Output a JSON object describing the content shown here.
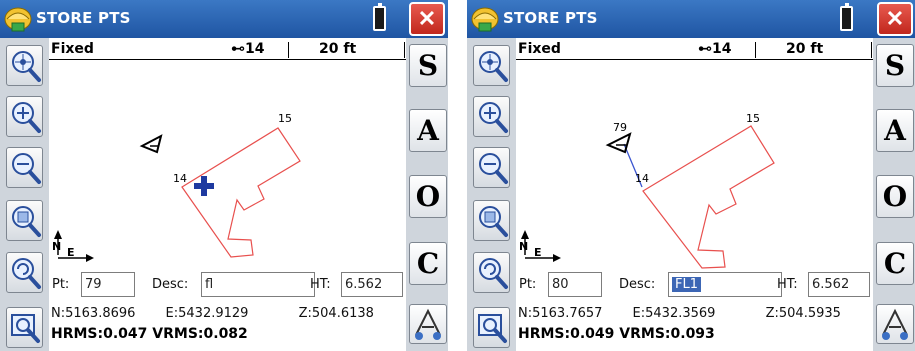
{
  "screens": [
    {
      "title": "STORE PTS",
      "status": "Fixed",
      "satellites": "14",
      "scale": "20 ft",
      "side_buttons": [
        "S",
        "A",
        "O",
        "C"
      ],
      "labels": {
        "pt": "Pt:",
        "desc": "Desc:",
        "ht": "HT:"
      },
      "pt_value": "79",
      "desc_value": "fl",
      "ht_value": "6.562",
      "north": "N:5163.8696",
      "east": "E:5432.9129",
      "elev": "Z:504.6138",
      "hrms": "HRMS:0.047",
      "vrms": "VRMS:0.082",
      "map_labels": {
        "p15": "15",
        "p14": "14",
        "p79": "",
        "north_arrow": "N",
        "east_arrow": "E"
      }
    },
    {
      "title": "STORE PTS",
      "status": "Fixed",
      "satellites": "14",
      "scale": "20 ft",
      "side_buttons": [
        "S",
        "A",
        "O",
        "C"
      ],
      "labels": {
        "pt": "Pt:",
        "desc": "Desc:",
        "ht": "HT:"
      },
      "pt_value": "80",
      "desc_value": "FL1",
      "ht_value": "6.562",
      "north": "N:5163.7657",
      "east": "E:5432.3569",
      "elev": "Z:504.5935",
      "hrms": "HRMS:0.049",
      "vrms": "VRMS:0.093",
      "map_labels": {
        "p15": "15",
        "p14": "14",
        "p79": "79",
        "north_arrow": "N",
        "east_arrow": "E"
      }
    }
  ],
  "icons": [
    "store-pts-app-icon",
    "battery-icon",
    "close-icon",
    "zoom-extents-icon",
    "zoom-in-icon",
    "zoom-out-icon",
    "zoom-window-icon",
    "zoom-previous-icon",
    "map-options-icon",
    "survey-rod-icon",
    "gps-position-icon",
    "crosshair-icon"
  ],
  "colors": {
    "title_bar": "#1f55a3",
    "close_button": "#c1271d",
    "polygon": "#e8504e",
    "position_marker": "#1e3aa0",
    "selection": "#3c66b5"
  }
}
